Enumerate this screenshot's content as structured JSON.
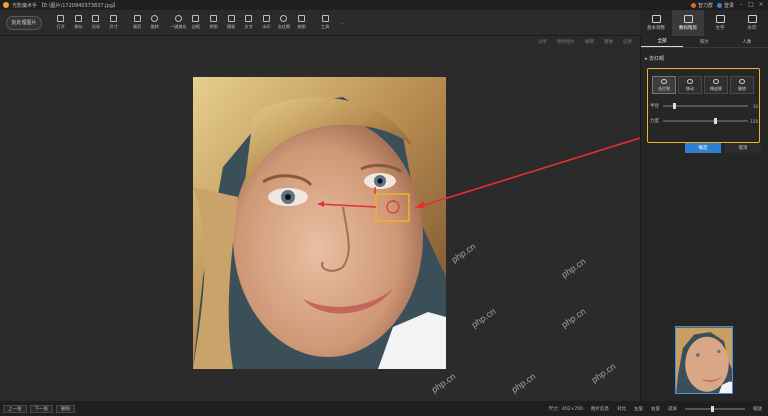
{
  "title": {
    "app_name": "光影魔术手",
    "file_path": "【E:\\图片\\1720940373837.jpg】",
    "user_label": "智力群",
    "login_label": "登录"
  },
  "toolbar": {
    "batch_label": "批处理图片",
    "tools": [
      {
        "icon": "open-icon",
        "label": "打开"
      },
      {
        "icon": "save-icon",
        "label": "保存"
      },
      {
        "icon": "save-as-icon",
        "label": "另存"
      },
      {
        "icon": "size-icon",
        "label": "尺寸"
      },
      {
        "icon": "crop-icon",
        "label": "裁剪"
      },
      {
        "icon": "rotate-icon",
        "label": "旋转"
      },
      {
        "icon": "one-click-icon",
        "label": "一键美化"
      },
      {
        "icon": "frame-icon",
        "label": "边框"
      },
      {
        "icon": "puzzle-icon",
        "label": "拼图"
      },
      {
        "icon": "template-icon",
        "label": "模板"
      },
      {
        "icon": "text-icon",
        "label": "文字"
      },
      {
        "icon": "watermark-icon",
        "label": "水印"
      },
      {
        "icon": "redeye-icon",
        "label": "去红眼"
      },
      {
        "icon": "fix-icon",
        "label": "修图"
      },
      {
        "icon": "tools-icon",
        "label": "工具"
      },
      {
        "icon": "more-icon",
        "label": "..."
      }
    ]
  },
  "right_tabs": [
    {
      "icon": "basic-adjust-icon",
      "label": "基本调整",
      "active": false
    },
    {
      "icon": "digital-darkroom-icon",
      "label": "数码暗房",
      "active": true
    },
    {
      "icon": "text-tab-icon",
      "label": "文字"
    },
    {
      "icon": "watermark-tab-icon",
      "label": "水印"
    }
  ],
  "subbar": {
    "items": [
      "分享",
      "原始图片",
      "撤销",
      "重做",
      "还原"
    ]
  },
  "sub_tabs": [
    "全部",
    "照片",
    "人像"
  ],
  "panel": {
    "section_title": "去红眼",
    "modes": [
      {
        "icon": "redeye-mode-icon",
        "label": "去红眼",
        "active": true
      },
      {
        "icon": "move-icon",
        "label": "移动"
      },
      {
        "icon": "eraser-icon",
        "label": "橡皮擦"
      },
      {
        "icon": "undo-icon",
        "label": "撤销"
      }
    ],
    "sliders": [
      {
        "label": "半径",
        "value": "10",
        "position": 0.12
      },
      {
        "label": "力度",
        "value": "150",
        "position": 0.6
      }
    ],
    "confirm_label": "确定",
    "cancel_label": "取消"
  },
  "statusbar": {
    "prev_label": "上一张",
    "next_label": "下一张",
    "delete_label": "删除",
    "size_info": "尺寸：402×700",
    "info": "图片信息",
    "compare": "对比",
    "rotate_left": "左旋",
    "rotate_right": "右旋",
    "fit": "适屏",
    "zoom": "缩放"
  },
  "watermark": "php.cn",
  "colors": {
    "accent": "#2e7fd1",
    "highlight_box": "#f3b12a",
    "arrow": "#e23131"
  }
}
